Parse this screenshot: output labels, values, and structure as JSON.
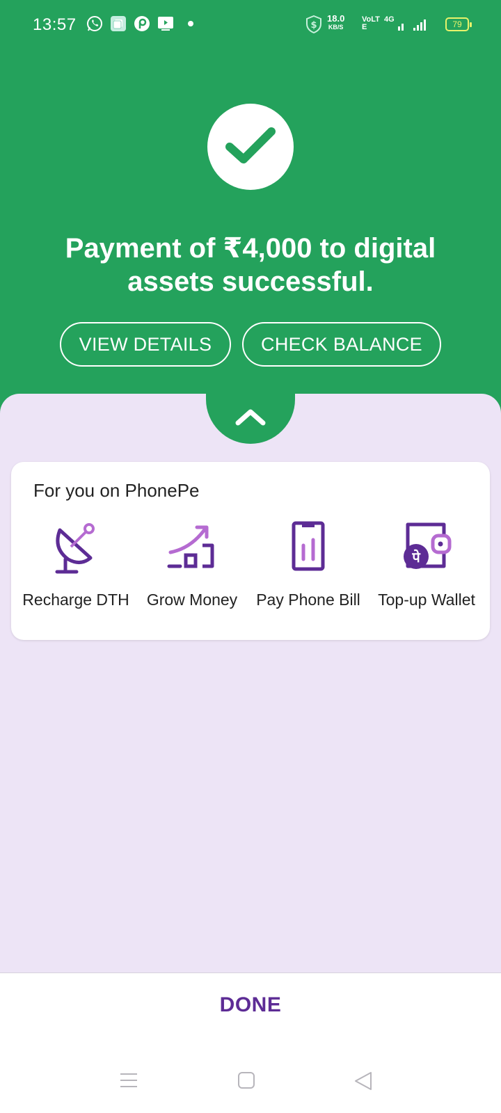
{
  "status_bar": {
    "time": "13:57",
    "network_speed": "18.0",
    "network_unit": "KB/S",
    "volte": "VoLTE",
    "network_type": "4G",
    "battery": "79",
    "icons": [
      "whatsapp-icon",
      "notification-icon",
      "phonepe-icon",
      "tv-icon",
      "shield-dollar-icon",
      "signal-icon"
    ]
  },
  "header": {
    "message": "Payment of ₹4,000 to digital assets successful.",
    "view_details_label": "VIEW DETAILS",
    "check_balance_label": "CHECK BALANCE"
  },
  "for_you": {
    "title": "For you on PhonePe",
    "items": [
      {
        "label": "Recharge DTH",
        "icon": "satellite-dish-icon"
      },
      {
        "label": "Grow Money",
        "icon": "growth-chart-icon"
      },
      {
        "label": "Pay Phone Bill",
        "icon": "phone-bill-icon"
      },
      {
        "label": "Top-up Wallet",
        "icon": "wallet-icon"
      }
    ]
  },
  "footer": {
    "done_label": "DONE"
  },
  "colors": {
    "brand_green": "#24a25c",
    "sheet_lavender": "#ede4f6",
    "brand_purple": "#5d2c95",
    "icon_light_purple": "#b56bd1"
  }
}
